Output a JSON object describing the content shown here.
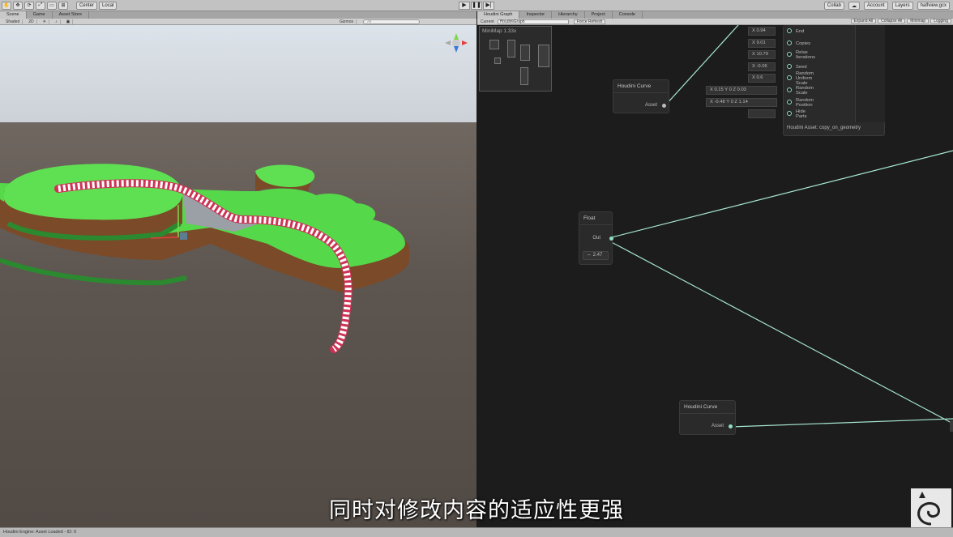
{
  "toolbar": {
    "pivot": "Center",
    "space": "Local",
    "play_icon": "play-icon",
    "pause_icon": "pause-icon",
    "step_icon": "step-icon",
    "collab": "Collab",
    "account": "Account",
    "layers": "Layers",
    "layout": "halfview.gcx"
  },
  "left_tabs": [
    {
      "label": "Scene"
    },
    {
      "label": "Game"
    },
    {
      "label": "Asset Store"
    }
  ],
  "scene_bar": {
    "shading": "Shaded",
    "mode": "2D",
    "gizmos": "Gizmos",
    "search_placeholder": "All"
  },
  "right_tabs": [
    {
      "label": "Houdini Graph"
    },
    {
      "label": "Inspector"
    },
    {
      "label": "Hierarchy"
    },
    {
      "label": "Project"
    },
    {
      "label": "Console"
    }
  ],
  "graph_bar": {
    "current_label": "Current",
    "current_value": "HoudiniGraph",
    "force_refresh": "Force Refresh",
    "expand_all": "Expand All",
    "collapse_all": "Collapse All",
    "minimap": "Minimap",
    "logging": "Logging"
  },
  "minimap": {
    "title": "MiniMap  1.33x"
  },
  "nodes": {
    "curve_top": {
      "title": "Houdini Curve",
      "port": "Asset"
    },
    "float": {
      "title": "Float",
      "port": "Out",
      "value": "2.47"
    },
    "curve_bottom": {
      "title": "Houdini Curve",
      "port": "Asset"
    },
    "asset": {
      "title": "Houdini Asset: copy_on_geometry",
      "params": [
        {
          "value": "X  0.94",
          "label": "End"
        },
        {
          "value": "X  9.01",
          "label": "Copies"
        },
        {
          "value": "X  10.79",
          "label": "Relax Iterations"
        },
        {
          "value": "X  -0.06",
          "label": "Seed"
        },
        {
          "value": "X  0.6",
          "label": "Random Uniform Scale"
        },
        {
          "value": "X  0.15  Y  0      Z  0.03",
          "label": "Random Scale"
        },
        {
          "value": "X  -0.48  Y  0      Z  1.14",
          "label": "Random Position"
        },
        {
          "value": "",
          "label": "Hide Parts"
        }
      ]
    }
  },
  "status_bar": "Houdini Engine: Asset Loaded - ID: 0",
  "subtitle": "同时对修改内容的适应性更强",
  "colors": {
    "link": "#a8e8d6",
    "port": "#8fe0c5",
    "grass": "#5fe052",
    "dirt": "#7a4a2a"
  }
}
